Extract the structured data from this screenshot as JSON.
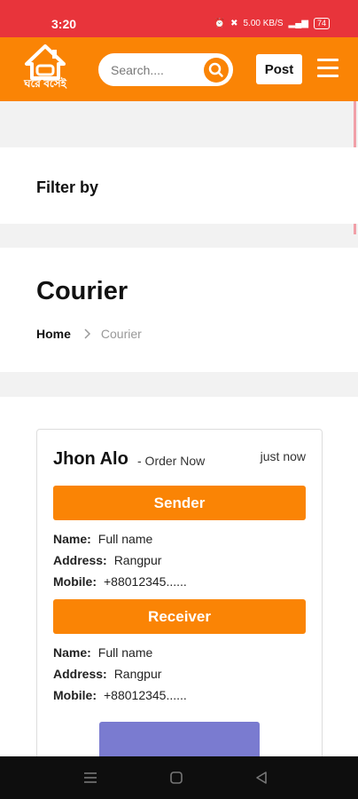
{
  "status_bar": {
    "time": "3:20",
    "indicators": "5.00 KB/S",
    "battery": "74"
  },
  "header": {
    "logo_text": "ঘরে বসেই",
    "search_placeholder": "Search....",
    "post_label": "Post"
  },
  "filter": {
    "title": "Filter by"
  },
  "page": {
    "heading": "Courier",
    "breadcrumb": {
      "home": "Home",
      "separator": ">",
      "current": "Courier"
    }
  },
  "card": {
    "name": "Jhon Alo",
    "order_text": "- Order Now",
    "time": "just now",
    "sender": {
      "title": "Sender",
      "name_label": "Name:",
      "name_value": "Full name",
      "address_label": "Address:",
      "address_value": "Rangpur",
      "mobile_label": "Mobile:",
      "mobile_value": "+88012345......"
    },
    "receiver": {
      "title": "Receiver",
      "name_label": "Name:",
      "name_value": "Full name",
      "address_label": "Address:",
      "address_value": "Rangpur",
      "mobile_label": "Mobile:",
      "mobile_value": "+88012345......"
    }
  },
  "colors": {
    "accent": "#fa8405",
    "status_bar": "#e8343b",
    "action": "#7a7bd0"
  },
  "icons": [
    "home-logo-icon",
    "search-icon",
    "hamburger-menu-icon",
    "chevron-right-icon",
    "recents-icon",
    "home-nav-icon",
    "back-icon"
  ]
}
